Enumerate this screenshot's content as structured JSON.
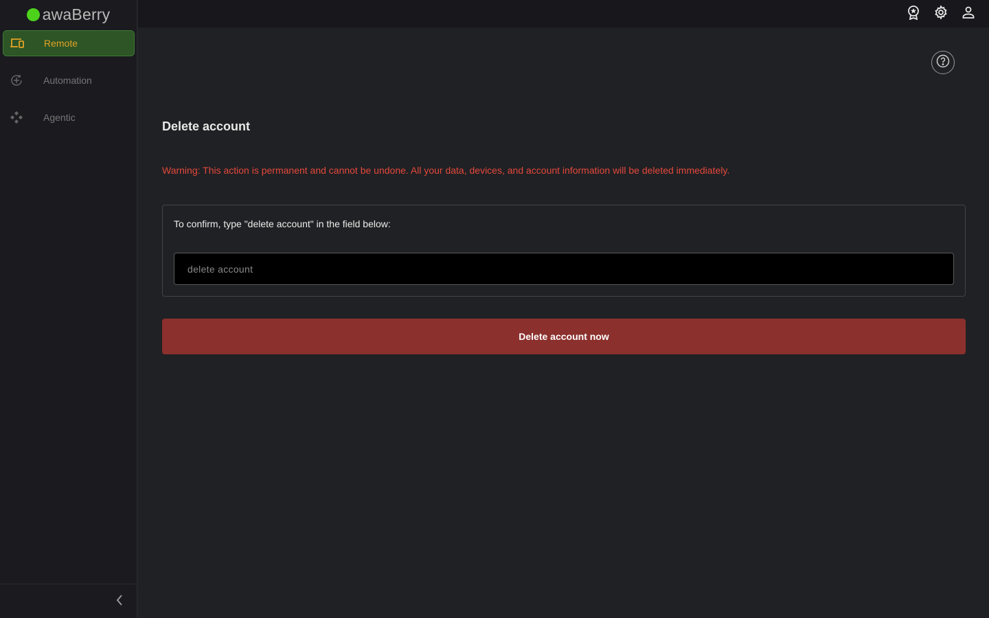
{
  "brand": {
    "name": "awaBerry"
  },
  "sidebar": {
    "items": [
      {
        "label": "Remote",
        "icon": "devices-icon",
        "active": true
      },
      {
        "label": "Automation",
        "icon": "automation-icon",
        "active": false
      },
      {
        "label": "Agentic",
        "icon": "agentic-icon",
        "active": false
      }
    ],
    "collapse_icon": "chevron-left-icon"
  },
  "topbar": {
    "icons": [
      "award-icon",
      "gear-icon",
      "user-icon"
    ]
  },
  "help": {
    "icon": "help-circle-icon"
  },
  "main": {
    "title": "Delete account",
    "warning": "Warning: This action is permanent and cannot be undone. All your data, devices, and account information will be deleted immediately.",
    "confirm_label": "To confirm, type \"delete account\" in the field below:",
    "confirm_placeholder": "delete account",
    "delete_button": "Delete account now"
  },
  "colors": {
    "accent_green": "#4dd21c",
    "active_label": "#e4a227",
    "warning": "#e5483c",
    "danger_button": "#8b302d"
  }
}
